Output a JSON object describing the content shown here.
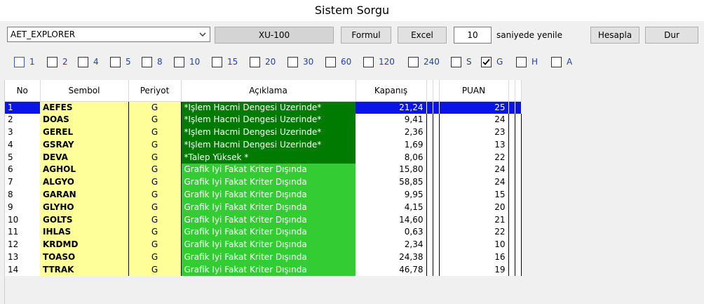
{
  "window": {
    "title": "Sistem Sorgu"
  },
  "toolbar": {
    "explorer_value": "AET_EXPLORER",
    "index_button": "XU-100",
    "formul_button": "Formul",
    "excel_button": "Excel",
    "refresh_seconds": "10",
    "refresh_label": "saniyede yenile",
    "hesapla_button": "Hesapla",
    "dur_button": "Dur"
  },
  "periods": [
    {
      "label": "1",
      "checked": false
    },
    {
      "label": "2",
      "checked": false
    },
    {
      "label": "4",
      "checked": false
    },
    {
      "label": "5",
      "checked": false
    },
    {
      "label": "8",
      "checked": false
    },
    {
      "label": "10",
      "checked": false
    },
    {
      "label": "15",
      "checked": false
    },
    {
      "label": "20",
      "checked": false
    },
    {
      "label": "30",
      "checked": false
    },
    {
      "label": "60",
      "checked": false
    },
    {
      "label": "120",
      "checked": false
    },
    {
      "label": "240",
      "checked": false
    },
    {
      "label": "S",
      "checked": false
    },
    {
      "label": "G",
      "checked": true
    },
    {
      "label": "H",
      "checked": false
    },
    {
      "label": "A",
      "checked": false
    }
  ],
  "grid": {
    "headers": {
      "no": "No",
      "symbol": "Sembol",
      "period": "Periyot",
      "desc": "Açıklama",
      "close": "Kapanış",
      "score": "PUAN"
    },
    "rows": [
      {
        "no": "1",
        "symbol": "AEFES",
        "period": "G",
        "desc": "*Işlem Hacmi Dengesi Uzerinde*",
        "close": "21,24",
        "score": "25",
        "tone": "dark"
      },
      {
        "no": "2",
        "symbol": "DOAS",
        "period": "G",
        "desc": "*Işlem Hacmi Dengesi Uzerinde*",
        "close": "9,41",
        "score": "24",
        "tone": "dark"
      },
      {
        "no": "3",
        "symbol": "GEREL",
        "period": "G",
        "desc": "*Işlem Hacmi Dengesi Uzerinde*",
        "close": "2,36",
        "score": "23",
        "tone": "dark"
      },
      {
        "no": "4",
        "symbol": "GSRAY",
        "period": "G",
        "desc": "*Işlem Hacmi Dengesi Uzerinde*",
        "close": "1,69",
        "score": "13",
        "tone": "dark"
      },
      {
        "no": "5",
        "symbol": "DEVA",
        "period": "G",
        "desc": "*Talep Yüksek *",
        "close": "8,06",
        "score": "22",
        "tone": "dark"
      },
      {
        "no": "6",
        "symbol": "AGHOL",
        "period": "G",
        "desc": "Grafik Iyi Fakat Kriter Dışında",
        "close": "15,80",
        "score": "24",
        "tone": "light"
      },
      {
        "no": "7",
        "symbol": "ALGYO",
        "period": "G",
        "desc": "Grafik Iyi Fakat Kriter Dışında",
        "close": "58,85",
        "score": "24",
        "tone": "light"
      },
      {
        "no": "8",
        "symbol": "GARAN",
        "period": "G",
        "desc": "Grafik Iyi Fakat Kriter Dışında",
        "close": "9,95",
        "score": "15",
        "tone": "light"
      },
      {
        "no": "9",
        "symbol": "GLYHO",
        "period": "G",
        "desc": "Grafik Iyi Fakat Kriter Dışında",
        "close": "4,15",
        "score": "20",
        "tone": "light"
      },
      {
        "no": "10",
        "symbol": "GOLTS",
        "period": "G",
        "desc": "Grafik Iyi Fakat Kriter Dışında",
        "close": "14,60",
        "score": "21",
        "tone": "light"
      },
      {
        "no": "11",
        "symbol": "IHLAS",
        "period": "G",
        "desc": "Grafik Iyi Fakat Kriter Dışında",
        "close": "0,63",
        "score": "22",
        "tone": "light"
      },
      {
        "no": "12",
        "symbol": "KRDMD",
        "period": "G",
        "desc": "Grafik Iyi Fakat Kriter Dışında",
        "close": "2,34",
        "score": "10",
        "tone": "light"
      },
      {
        "no": "13",
        "symbol": "TOASO",
        "period": "G",
        "desc": "Grafik Iyi Fakat Kriter Dışında",
        "close": "24,38",
        "score": "16",
        "tone": "light"
      },
      {
        "no": "14",
        "symbol": "TTRAK",
        "period": "G",
        "desc": "Grafik Iyi Fakat Kriter Dışında",
        "close": "46,78",
        "score": "19",
        "tone": "light"
      }
    ],
    "selected_row": "1"
  },
  "colors": {
    "selection": "#0a14e6",
    "symbol_bg": "#ffff99",
    "desc_dark": "#007a00",
    "desc_light": "#33cc33"
  }
}
